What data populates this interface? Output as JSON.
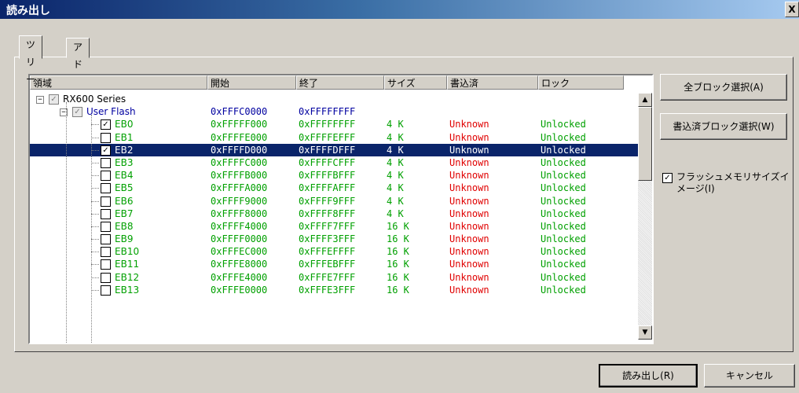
{
  "window": {
    "title": "読み出し",
    "close": "X"
  },
  "tabs": [
    {
      "label": "ツリー"
    },
    {
      "label": "アドレス"
    }
  ],
  "columns": [
    "領域",
    "開始",
    "終了",
    "サイズ",
    "書込済",
    "ロック"
  ],
  "root": {
    "label": "RX600 Series"
  },
  "group": {
    "label": "User Flash",
    "start": "0xFFFC0000",
    "end": "0xFFFFFFFF"
  },
  "blocks": [
    {
      "name": "EB0",
      "start": "0xFFFFF000",
      "end": "0xFFFFFFFF",
      "size": "4 K",
      "written": "Unknown",
      "lock": "Unlocked",
      "checked": true
    },
    {
      "name": "EB1",
      "start": "0xFFFFE000",
      "end": "0xFFFFEFFF",
      "size": "4 K",
      "written": "Unknown",
      "lock": "Unlocked",
      "checked": false
    },
    {
      "name": "EB2",
      "start": "0xFFFFD000",
      "end": "0xFFFFDFFF",
      "size": "4 K",
      "written": "Unknown",
      "lock": "Unlocked",
      "checked": true,
      "selected": true
    },
    {
      "name": "EB3",
      "start": "0xFFFFC000",
      "end": "0xFFFFCFFF",
      "size": "4 K",
      "written": "Unknown",
      "lock": "Unlocked",
      "checked": false
    },
    {
      "name": "EB4",
      "start": "0xFFFFB000",
      "end": "0xFFFFBFFF",
      "size": "4 K",
      "written": "Unknown",
      "lock": "Unlocked",
      "checked": false
    },
    {
      "name": "EB5",
      "start": "0xFFFFA000",
      "end": "0xFFFFAFFF",
      "size": "4 K",
      "written": "Unknown",
      "lock": "Unlocked",
      "checked": false
    },
    {
      "name": "EB6",
      "start": "0xFFFF9000",
      "end": "0xFFFF9FFF",
      "size": "4 K",
      "written": "Unknown",
      "lock": "Unlocked",
      "checked": false
    },
    {
      "name": "EB7",
      "start": "0xFFFF8000",
      "end": "0xFFFF8FFF",
      "size": "4 K",
      "written": "Unknown",
      "lock": "Unlocked",
      "checked": false
    },
    {
      "name": "EB8",
      "start": "0xFFFF4000",
      "end": "0xFFFF7FFF",
      "size": "16 K",
      "written": "Unknown",
      "lock": "Unlocked",
      "checked": false
    },
    {
      "name": "EB9",
      "start": "0xFFFF0000",
      "end": "0xFFFF3FFF",
      "size": "16 K",
      "written": "Unknown",
      "lock": "Unlocked",
      "checked": false
    },
    {
      "name": "EB10",
      "start": "0xFFFEC000",
      "end": "0xFFFEFFFF",
      "size": "16 K",
      "written": "Unknown",
      "lock": "Unlocked",
      "checked": false
    },
    {
      "name": "EB11",
      "start": "0xFFFE8000",
      "end": "0xFFFEBFFF",
      "size": "16 K",
      "written": "Unknown",
      "lock": "Unlocked",
      "checked": false
    },
    {
      "name": "EB12",
      "start": "0xFFFE4000",
      "end": "0xFFFE7FFF",
      "size": "16 K",
      "written": "Unknown",
      "lock": "Unlocked",
      "checked": false
    },
    {
      "name": "EB13",
      "start": "0xFFFE0000",
      "end": "0xFFFE3FFF",
      "size": "16 K",
      "written": "Unknown",
      "lock": "Unlocked",
      "checked": false
    }
  ],
  "buttons": {
    "select_all": "全ブロック選択(A)",
    "select_written": "書込済ブロック選択(W)",
    "read": "読み出し(R)",
    "cancel": "キャンセル"
  },
  "option": {
    "label": "フラッシュメモリサイズイメージ(I)",
    "checked": true
  },
  "colors": {
    "address": "#00a000",
    "unknown": "#e00000",
    "group": "#0000a0",
    "selection": "#0a246a"
  }
}
